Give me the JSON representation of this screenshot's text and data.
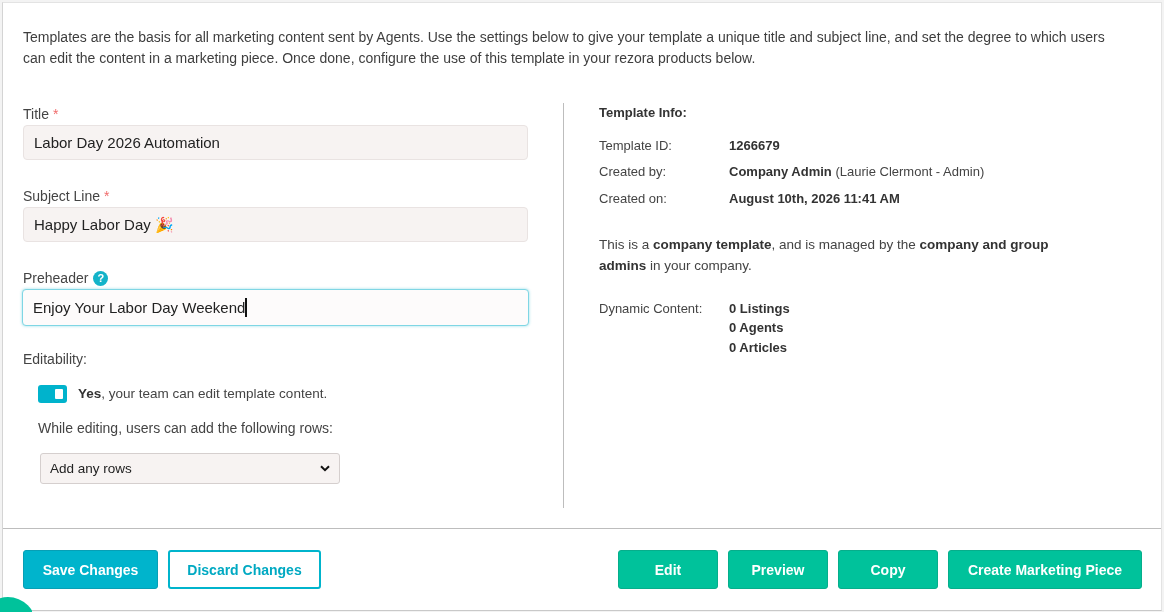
{
  "intro": "Templates are the basis for all marketing content sent by Agents. Use the settings below to give your template a unique title and subject line, and set the degree to which users can edit the content in a marketing piece. Once done, configure the use of this template in your rezora products below.",
  "form": {
    "fields": [
      {
        "label": "Title",
        "required_mark": "*",
        "value": "Labor Day 2026 Automation",
        "focused": false
      },
      {
        "label": "Subject Line",
        "required_mark": "*",
        "value": "Happy Labor Day 🎉",
        "focused": false
      },
      {
        "label": "Preheader",
        "help_icon": "?",
        "value": "Enjoy Your Labor Day Weekend",
        "focused": true
      }
    ],
    "editability": {
      "label": "Editability:",
      "toggle": {
        "on": true,
        "text": "**Yes**, your team can edit template content."
      },
      "rows_label": "While editing, users can add the following rows:",
      "rows_select": {
        "value": "Add any rows"
      }
    }
  },
  "template_info": {
    "heading": "Template Info:",
    "rows": [
      {
        "label": "Template ID:",
        "value": "1266679"
      },
      {
        "label": "Created by:",
        "value": "Company Admin",
        "note": "(Laurie Clermont - Admin)"
      },
      {
        "label": "Created on:",
        "value": "August 10th, 2026 11:41 AM"
      }
    ],
    "ownership": "This is a **company template**, and is managed by the **company and group admins** in your company.",
    "dynamic_content": {
      "label": "Dynamic Content:",
      "values": [
        "0 Listings",
        "0 Agents",
        "0 Articles"
      ]
    }
  },
  "footer": {
    "left_buttons": [
      {
        "label": "Save Changes",
        "kind": "primary"
      },
      {
        "label": "Discard Changes",
        "kind": "outline"
      }
    ],
    "right_buttons": [
      {
        "label": "Edit",
        "kind": "success"
      },
      {
        "label": "Preview",
        "kind": "success"
      },
      {
        "label": "Copy",
        "kind": "success"
      },
      {
        "label": "Create Marketing Piece",
        "kind": "success"
      }
    ]
  }
}
